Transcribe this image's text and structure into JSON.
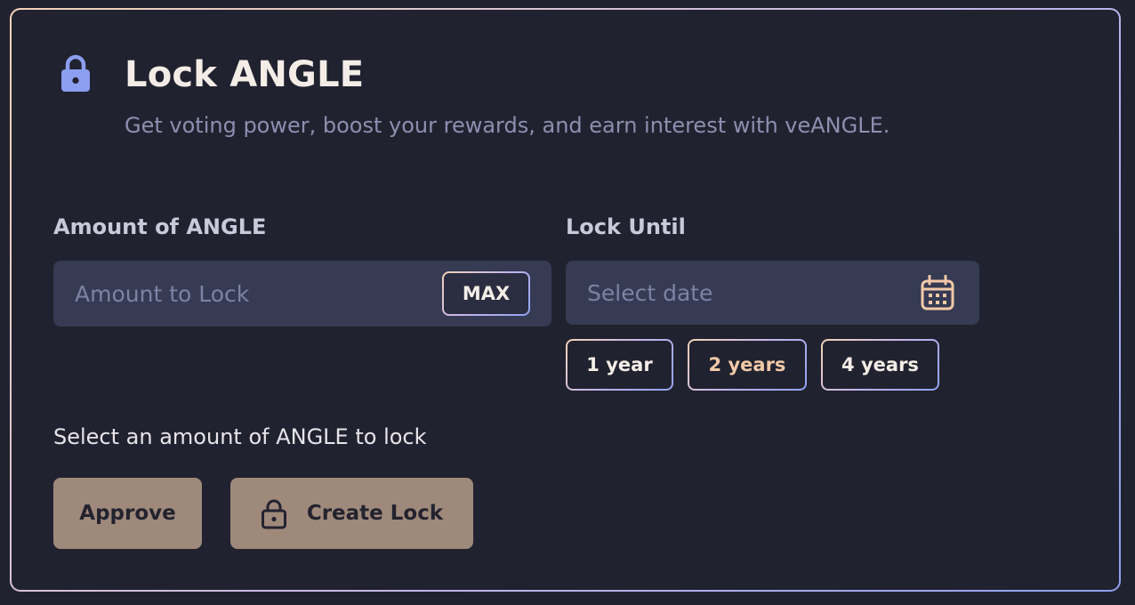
{
  "header": {
    "title": "Lock ANGLE",
    "subtitle": "Get voting power, boost your rewards, and earn interest with veANGLE.",
    "icon": "lock-icon"
  },
  "amount": {
    "label": "Amount of ANGLE",
    "placeholder": "Amount to Lock",
    "value": "",
    "max_label": "MAX"
  },
  "lock_until": {
    "label": "Lock Until",
    "placeholder": "Select date",
    "value": "",
    "icon": "calendar-icon",
    "presets": [
      {
        "label": "1 year",
        "active": false
      },
      {
        "label": "2 years",
        "active": true
      },
      {
        "label": "4 years",
        "active": false
      }
    ]
  },
  "status": {
    "text": "Select an amount of ANGLE to lock"
  },
  "actions": {
    "approve_label": "Approve",
    "create_lock_label": "Create Lock"
  },
  "colors": {
    "background": "#21222f",
    "accent_icon": "#8b9ef0",
    "calendar": "#f1c9a8",
    "button_fill": "#9f897b"
  }
}
